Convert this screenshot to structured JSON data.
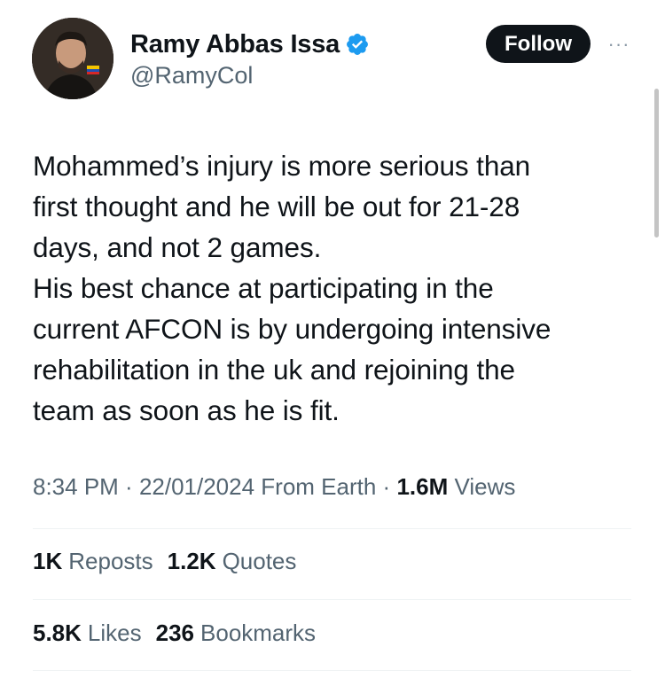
{
  "author": {
    "display_name": "Ramy Abbas Issa",
    "handle": "@RamyCol",
    "verified": true,
    "verified_color": "#1d9bf0"
  },
  "actions": {
    "follow_label": "Follow",
    "more_label": "···"
  },
  "tweet": {
    "text": "Mohammed’s injury is more serious than\nfirst thought and he will be out for 21-28\ndays, and not 2 games.\nHis best chance at participating in the\ncurrent AFCON is by undergoing intensive\nrehabilitation in the uk and rejoining the\nteam as soon as he is fit."
  },
  "meta": {
    "time": "8:34 PM",
    "separator": " · ",
    "date": "22/01/2024",
    "source": " From Earth",
    "views_count": "1.6M",
    "views_label": "Views"
  },
  "stats": {
    "reposts_count": "1K",
    "reposts_label": "Reposts",
    "quotes_count": "1.2K",
    "quotes_label": "Quotes",
    "likes_count": "5.8K",
    "likes_label": "Likes",
    "bookmarks_count": "236",
    "bookmarks_label": "Bookmarks"
  },
  "colors": {
    "text_primary": "#0f1419",
    "text_secondary": "#536471",
    "divider": "#eff3f4",
    "follow_bg": "#0f1419"
  }
}
